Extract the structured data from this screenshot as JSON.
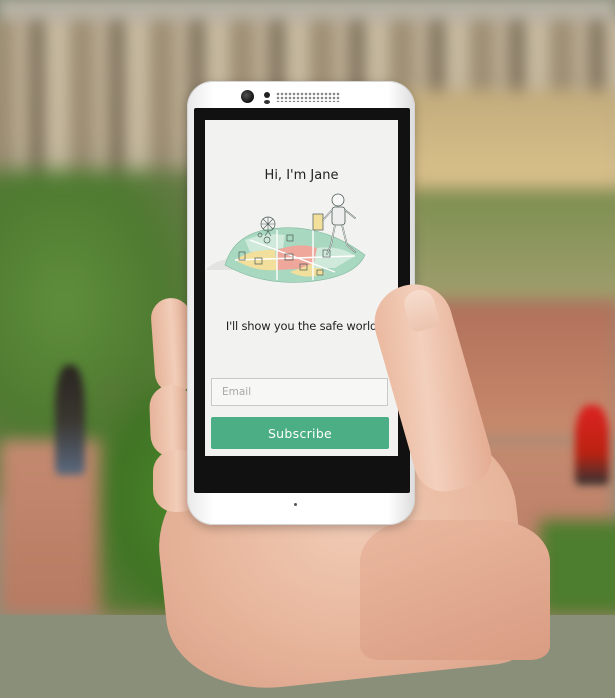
{
  "app": {
    "greeting": "Hi, I'm Jane",
    "tagline": "I'll show you the safe world",
    "email_placeholder": "Email",
    "email_value": "",
    "subscribe_label": "Subscribe",
    "illustration_icon": "city-map-robot-illustration",
    "colors": {
      "accent": "#4cae84",
      "map_green": "#a9d8c0",
      "map_yellow": "#f2df9c",
      "map_pink": "#eea79a",
      "screen_bg": "#f2f2f1"
    }
  },
  "device": {
    "camera_icon": "front-camera-icon",
    "speaker_icon": "speaker-grille-icon"
  }
}
